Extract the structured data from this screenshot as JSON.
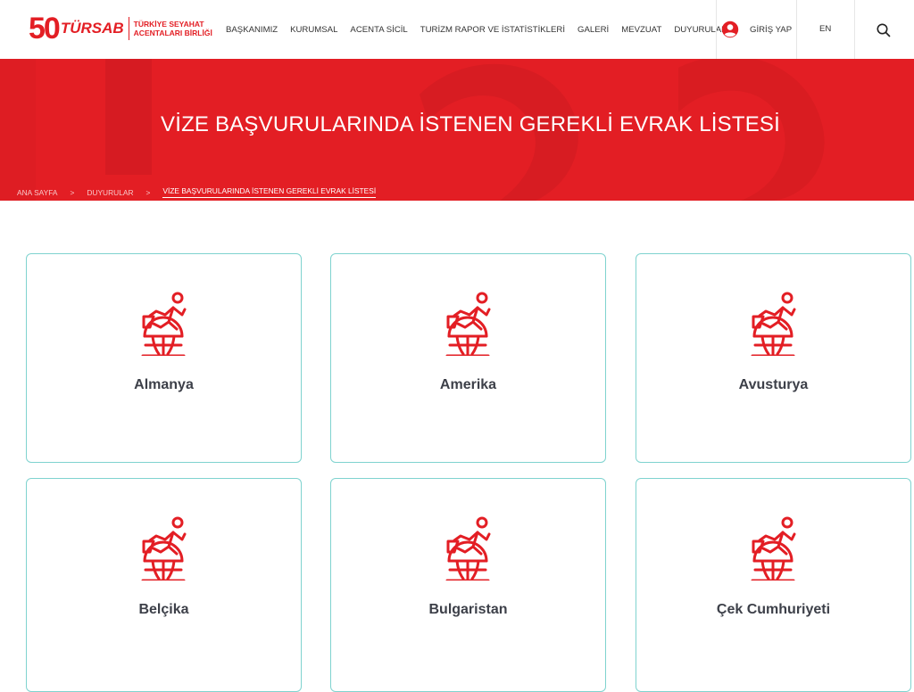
{
  "header": {
    "logo": {
      "number": "50",
      "brand": "TÜRSAB",
      "subtitle_line1": "TÜRKİYE SEYAHAT",
      "subtitle_line2": "ACENTALARI BİRLİĞİ"
    },
    "nav": [
      {
        "label": "BAŞKANIMIZ"
      },
      {
        "label": "KURUMSAL"
      },
      {
        "label": "ACENTA SİCİL"
      },
      {
        "label": "TURİZM RAPOR VE İSTATİSTİKLERİ"
      },
      {
        "label": "GALERİ"
      },
      {
        "label": "MEVZUAT"
      },
      {
        "label": "DUYURULAR"
      }
    ],
    "login_label": "GİRİŞ YAP",
    "lang_label": "EN",
    "search_icon": "search-icon",
    "user_icon": "user-circle-icon"
  },
  "banner": {
    "title": "VİZE BAŞVURULARINDA İSTENEN GEREKLİ EVRAK LİSTESİ",
    "breadcrumb": [
      "ANA SAYFA",
      "DUYURULAR",
      "VİZE BAŞVURULARINDA İSTENEN GEREKLİ EVRAK LİSTESİ"
    ]
  },
  "cards": [
    {
      "label": "Almanya"
    },
    {
      "label": "Amerika"
    },
    {
      "label": "Avusturya"
    },
    {
      "label": "Belçika"
    },
    {
      "label": "Bulgaristan"
    },
    {
      "label": "Çek Cumhuriyeti"
    }
  ],
  "colors": {
    "brand_red": "#e31e24",
    "card_border": "#7fd3cf",
    "text_dark": "#3d4049"
  },
  "card_icon": "traveler-globe-icon"
}
